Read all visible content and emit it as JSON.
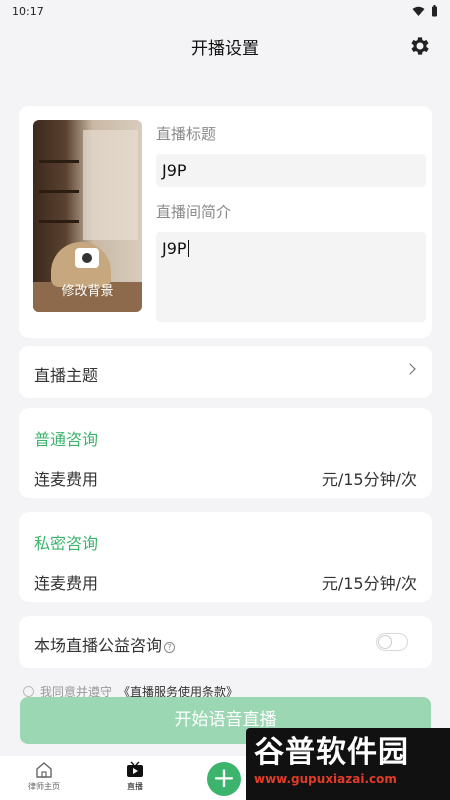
{
  "status": {
    "time": "10:17"
  },
  "header": {
    "title": "开播设置"
  },
  "cover": {
    "label": "修改背景"
  },
  "form": {
    "title_label": "直播标题",
    "title_value": "J9P",
    "intro_label": "直播间简介",
    "intro_value": "J9P"
  },
  "topic": {
    "label": "直播主题"
  },
  "normal_consult": {
    "title": "普通咨询",
    "row_label": "连麦费用",
    "row_value": "元/15分钟/次"
  },
  "private_consult": {
    "title": "私密咨询",
    "row_label": "连麦费用",
    "row_value": "元/15分钟/次"
  },
  "charity": {
    "label": "本场直播公益咨询",
    "enabled": false
  },
  "agreement": {
    "text": "我同意并遵守",
    "link": "《直播服务使用条款》"
  },
  "start_button": {
    "label": "开始语音直播"
  },
  "tabs": [
    {
      "label": "律师主页"
    },
    {
      "label": "直播"
    }
  ],
  "watermark": {
    "brand": "谷普软件园",
    "url": "www.gupuxiazai.com"
  },
  "colors": {
    "accent": "#3cb46e",
    "button_disabled": "#9ad7b2",
    "background": "#f4f4f6"
  }
}
